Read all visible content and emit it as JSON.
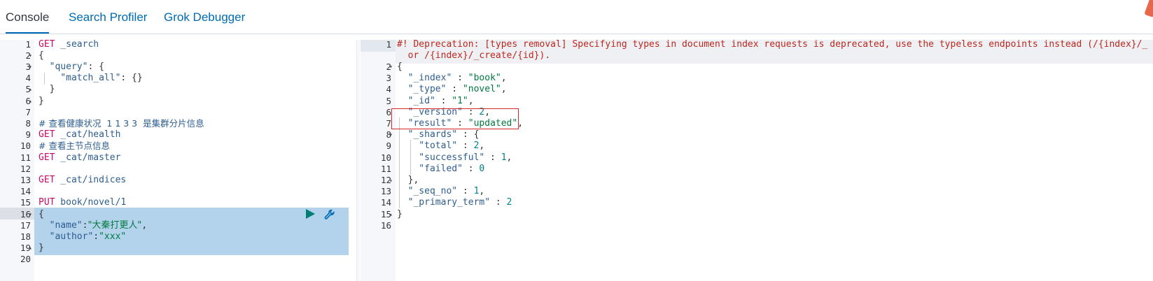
{
  "tabs": [
    {
      "label": "Console",
      "active": true
    },
    {
      "label": "Search Profiler",
      "active": false
    },
    {
      "label": "Grok Debugger",
      "active": false
    }
  ],
  "colors": {
    "accent": "#006bb4",
    "method": "#c80a68",
    "string": "#007a3e",
    "key": "#2d5d8f",
    "warning": "#bd271e",
    "selection": "#b3d3ec",
    "annotation_box": "#d62728"
  },
  "icons": {
    "run": "play-icon",
    "settings": "wrench-icon"
  },
  "request_editor": {
    "line_numbers": [
      "1",
      "2",
      "3",
      "4",
      "5",
      "6",
      "7",
      "8",
      "9",
      "10",
      "11",
      "12",
      "13",
      "14",
      "15",
      "16",
      "17",
      "18",
      "19",
      "20"
    ],
    "lines": {
      "l1_method": "GET",
      "l1_url": " _search",
      "l2": "{",
      "l3_key": "  \"query\"",
      "l3_rest": ": {",
      "l4_key": "    \"match_all\"",
      "l4_rest": ": {}",
      "l5": "  }",
      "l6": "}",
      "l8": "# 查看健康状况  1 1 3 3  是集群分片信息",
      "l9_method": "GET",
      "l9_url": " _cat/health",
      "l10": "# 查看主节点信息",
      "l11_method": "GET",
      "l11_url": " _cat/master",
      "l13_method": "GET",
      "l13_url": " _cat/indices",
      "l15_method": "PUT",
      "l15_url": " book/novel/1",
      "l16": "{",
      "l17_key": "  \"name\"",
      "l17_colon": ":",
      "l17_val": "\"大秦打更人\"",
      "l17_tail": ",",
      "l18_key": "  \"author\"",
      "l18_colon": ":",
      "l18_val": "\"xxx\"",
      "l19": "}"
    }
  },
  "response_editor": {
    "line_numbers": [
      "1",
      "2",
      "3",
      "4",
      "5",
      "6",
      "7",
      "8",
      "9",
      "10",
      "11",
      "12",
      "13",
      "14",
      "15",
      "16"
    ],
    "lines": {
      "warn1": "#! Deprecation: [types removal] Specifying types in document index requests is deprecated, use the typeless endpoints instead (/{index}/_",
      "warn2": "  or /{index}/_create/{id}).",
      "l2": "{",
      "l3_key": "  \"_index\"",
      "l3_colon": " : ",
      "l3_val": "\"book\"",
      "l3_tail": ",",
      "l4_key": "  \"_type\"",
      "l4_colon": " : ",
      "l4_val": "\"novel\"",
      "l4_tail": ",",
      "l5_key": "  \"_id\"",
      "l5_colon": " : ",
      "l5_val": "\"1\"",
      "l5_tail": ",",
      "l6_key": "  \"_version\"",
      "l6_colon": " : ",
      "l6_val": "2",
      "l6_tail": ",",
      "l7_key": "  \"result\"",
      "l7_colon": " : ",
      "l7_val": "\"updated\"",
      "l7_tail": ",",
      "l8_key": "  \"_shards\"",
      "l8_rest": " : {",
      "l9_key": "    \"total\"",
      "l9_colon": " : ",
      "l9_val": "2",
      "l9_tail": ",",
      "l10_key": "    \"successful\"",
      "l10_colon": " : ",
      "l10_val": "1",
      "l10_tail": ",",
      "l11_key": "    \"failed\"",
      "l11_colon": " : ",
      "l11_val": "0",
      "l12": "  },",
      "l13_key": "  \"_seq_no\"",
      "l13_colon": " : ",
      "l13_val": "1",
      "l13_tail": ",",
      "l14_key": "  \"_primary_term\"",
      "l14_colon": " : ",
      "l14_val": "2",
      "l15": "}"
    }
  }
}
